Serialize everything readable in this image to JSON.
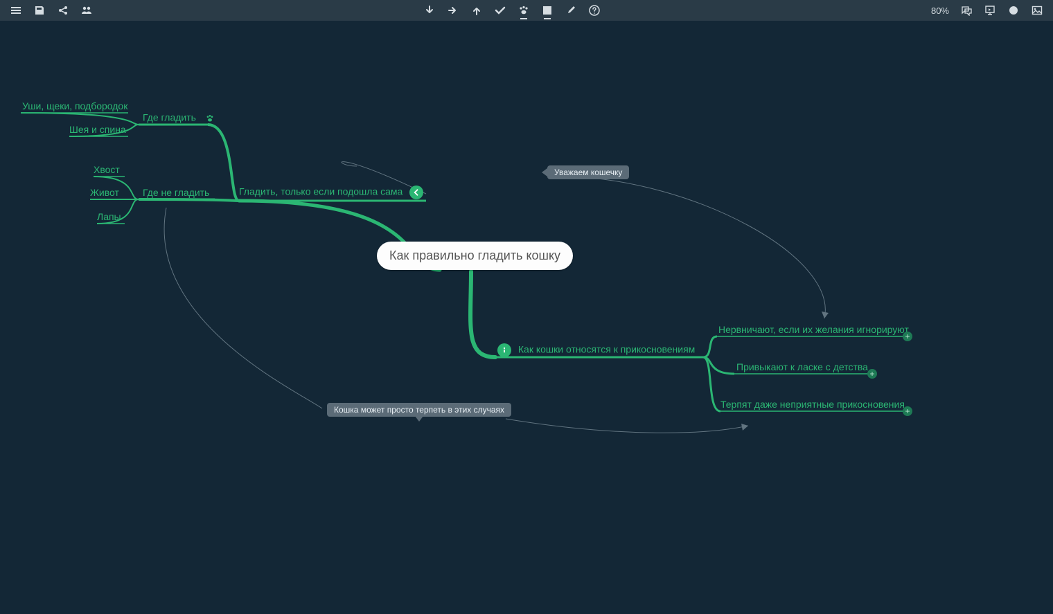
{
  "toolbar": {
    "zoom_label": "80%"
  },
  "mindmap": {
    "root": "Как правильно гладить кошку",
    "left_branch": {
      "main": "Гладить, только если подошла сама",
      "where_pet": {
        "label": "Где гладить",
        "children": [
          "Уши, щеки, подбородок",
          "Шея и спина"
        ]
      },
      "where_not": {
        "label": "Где не гладить",
        "children": [
          "Хвост",
          "Живот",
          "Лапы"
        ]
      }
    },
    "right_branch": {
      "main": "Как кошки относятся к прикосновениям",
      "children": [
        "Нервничают, если их желания игнорируют",
        "Привыкают к ласке с детства",
        "Терпят даже неприятные прикосновения"
      ]
    }
  },
  "notes": {
    "respect": "Уважаем кошечку",
    "tolerate": "Кошка может просто терпеть в этих случаях"
  },
  "colors": {
    "background": "#132736",
    "toolbar": "#2a3b47",
    "branch": "#2bb673",
    "note": "#5b6b77",
    "root_bg": "#fdfdfd"
  }
}
